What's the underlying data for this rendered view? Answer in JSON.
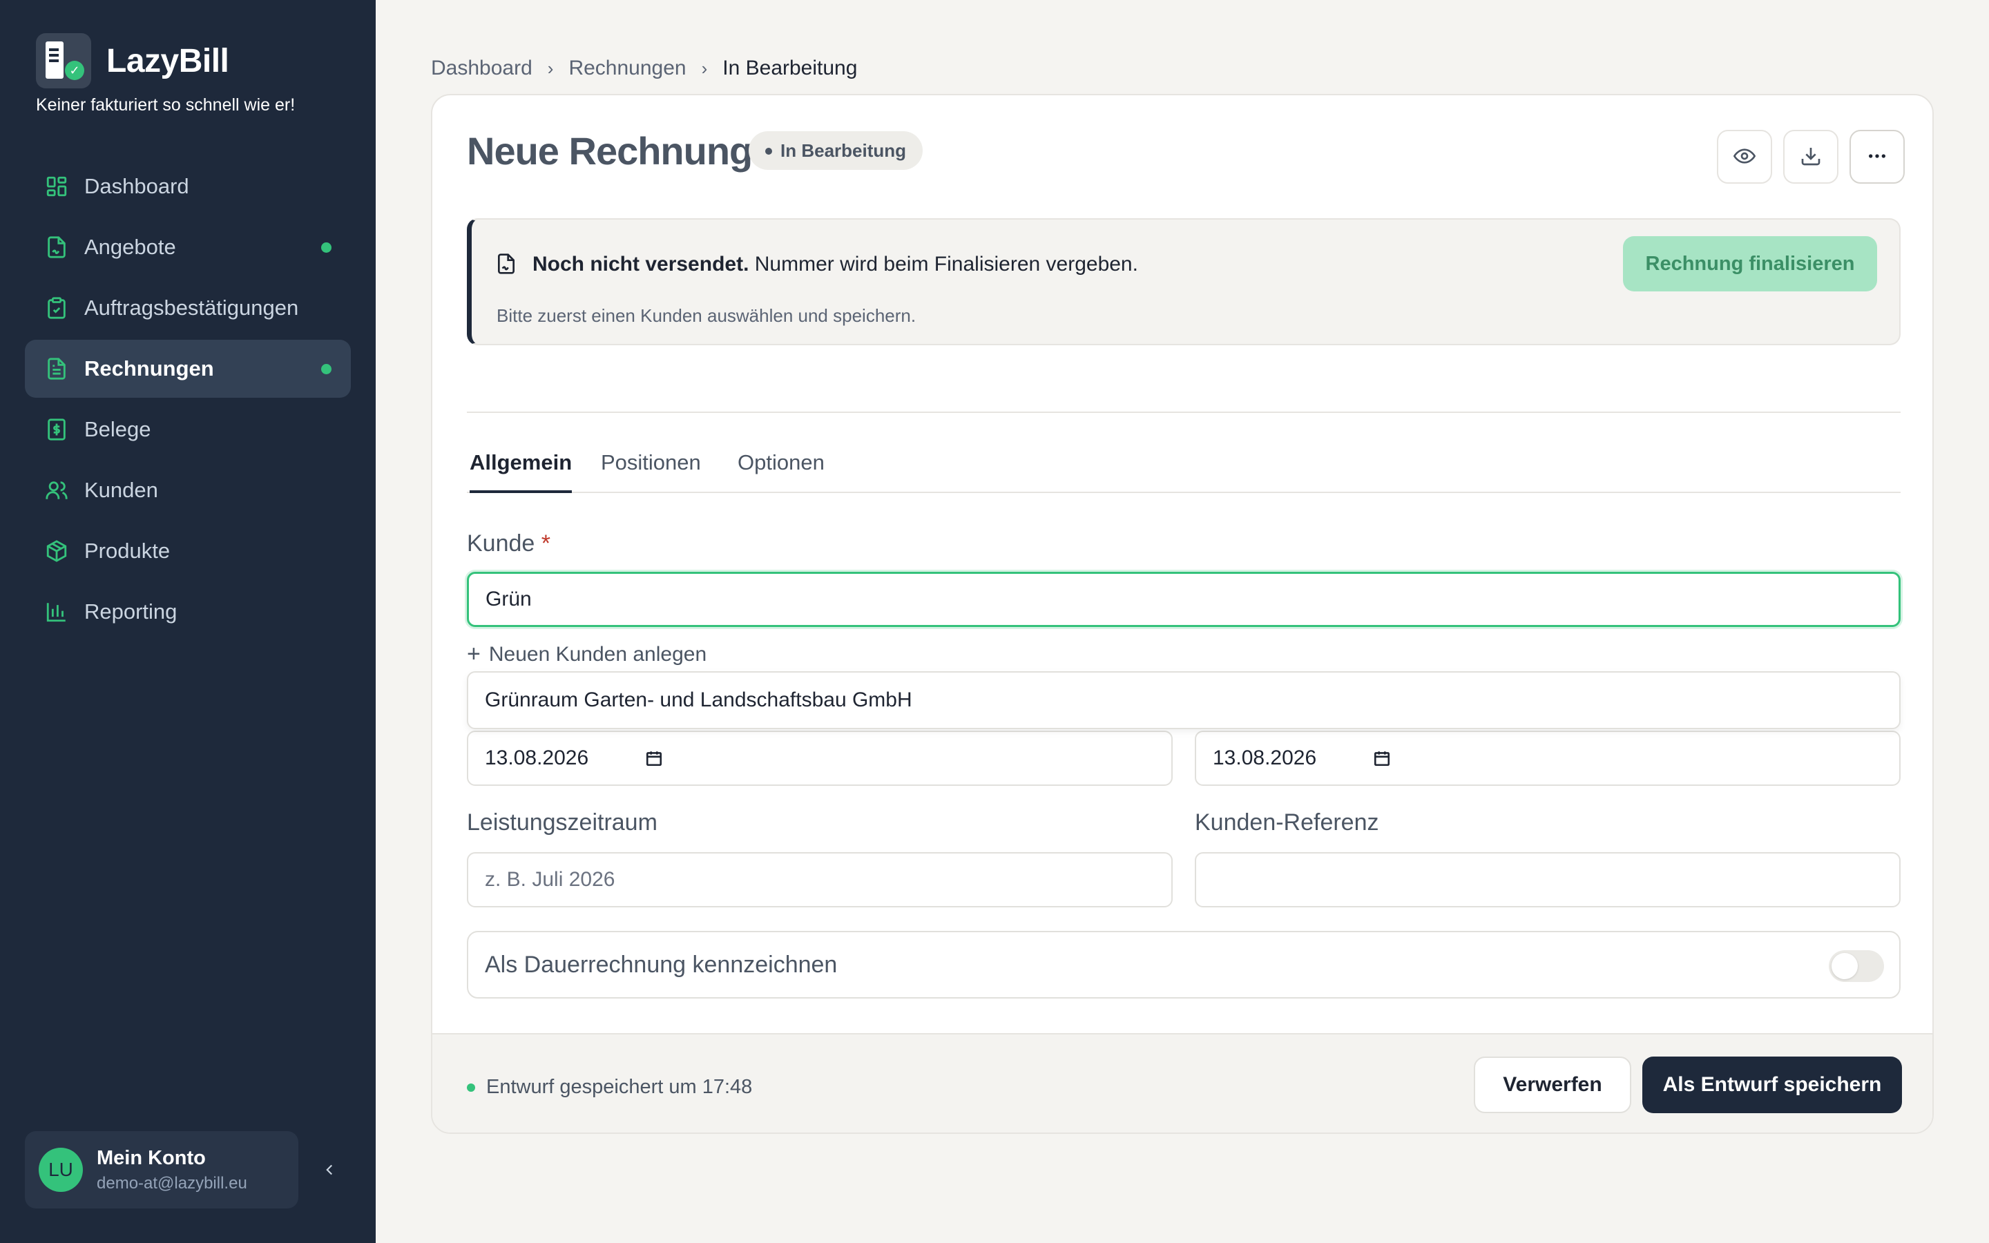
{
  "app": {
    "name": "LazyBill",
    "tagline": "Keiner fakturiert so schnell wie er!"
  },
  "sidebar": {
    "items": [
      {
        "label": "Dashboard",
        "icon": "dashboard-icon"
      },
      {
        "label": "Angebote",
        "icon": "file-signature-icon",
        "dot": true
      },
      {
        "label": "Auftragsbestätigungen",
        "icon": "clipboard-check-icon"
      },
      {
        "label": "Rechnungen",
        "icon": "file-text-icon",
        "dot": true,
        "active": true
      },
      {
        "label": "Belege",
        "icon": "receipt-dollar-icon"
      },
      {
        "label": "Kunden",
        "icon": "users-icon"
      },
      {
        "label": "Produkte",
        "icon": "package-icon"
      },
      {
        "label": "Reporting",
        "icon": "bar-chart-icon"
      }
    ],
    "account": {
      "initials": "LU",
      "name": "Mein Konto",
      "email": "demo-at@lazybill.eu"
    }
  },
  "breadcrumb": {
    "items": [
      "Dashboard",
      "Rechnungen"
    ],
    "current": "In Bearbeitung"
  },
  "header": {
    "title": "Neue Rechnung",
    "status": "In Bearbeitung",
    "actions": [
      "eye-icon",
      "download-icon",
      "more-icon"
    ]
  },
  "notice": {
    "title": "Noch nicht versendet.",
    "text": "Nummer wird beim Finalisieren vergeben.",
    "hint": "Bitte zuerst einen Kunden auswählen und speichern.",
    "button": "Rechnung finalisieren"
  },
  "tabs": [
    {
      "label": "Allgemein",
      "active": true
    },
    {
      "label": "Positionen"
    },
    {
      "label": "Optionen"
    }
  ],
  "form": {
    "customer": {
      "label": "Kunde",
      "required_mark": "*",
      "value": "Grün",
      "new_label": "Neuen Kunden anlegen",
      "suggestion": "Grünraum Garten- und Landschaftsbau GmbH"
    },
    "date_left": "13.08.2026",
    "date_right": "13.08.2026",
    "period": {
      "label": "Leistungszeitraum",
      "placeholder": "z. B. Juli 2026"
    },
    "reference": {
      "label": "Kunden-Referenz",
      "value": ""
    },
    "recurring": {
      "label": "Als Dauerrechnung kennzeichnen",
      "enabled": false
    }
  },
  "footer": {
    "save_status": "Entwurf gespeichert um 17:48",
    "discard": "Verwerfen",
    "save": "Als Entwurf speichern"
  },
  "colors": {
    "sidebar": "#1e293b",
    "accent": "#34c27b",
    "primary_button": "#1e293b",
    "finalize_disabled": "#a7e4c4"
  }
}
